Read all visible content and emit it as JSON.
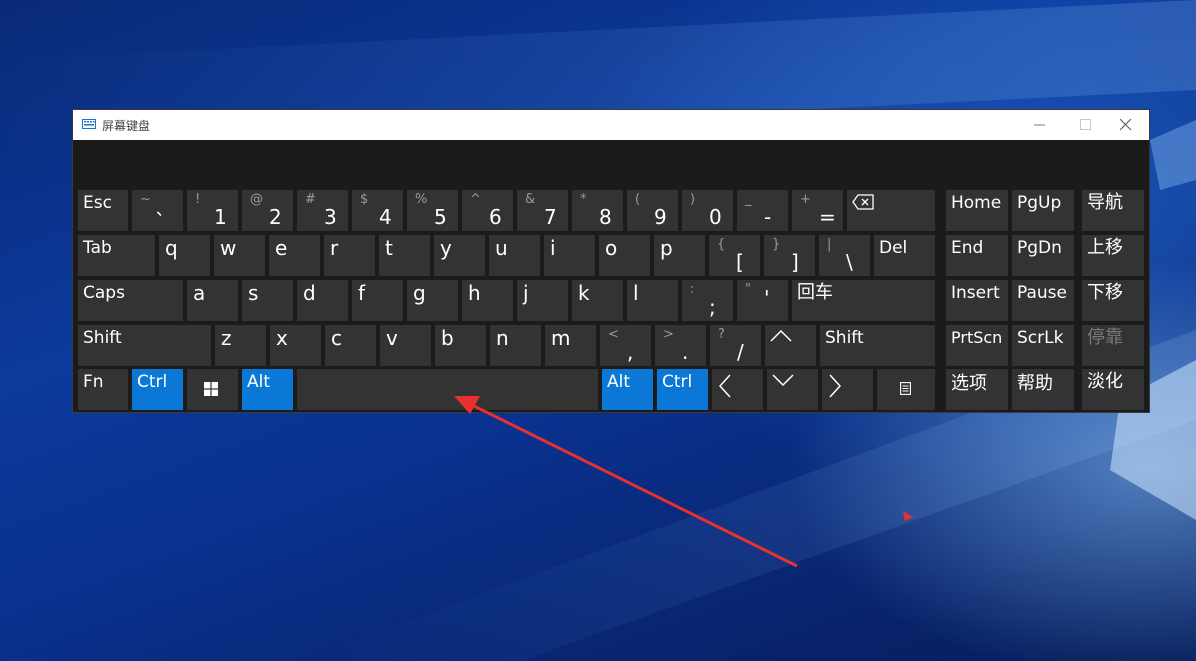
{
  "window": {
    "title": "屏幕键盘",
    "minimize_label": "—",
    "maximize_label": "☐",
    "close_label": "✕"
  },
  "keys": {
    "esc": "Esc",
    "backtick_sec": "~",
    "backtick_pri": "、",
    "n1_sec": "!",
    "n1_pri": "1",
    "n2_sec": "@",
    "n2_pri": "2",
    "n3_sec": "#",
    "n3_pri": "3",
    "n4_sec": "$",
    "n4_pri": "4",
    "n5_sec": "%",
    "n5_pri": "5",
    "n6_sec": "^",
    "n6_pri": "6",
    "n7_sec": "&",
    "n7_pri": "7",
    "n8_sec": "*",
    "n8_pri": "8",
    "n9_sec": "(",
    "n9_pri": "9",
    "n0_sec": ")",
    "n0_pri": "0",
    "minus_sec": "_",
    "minus_pri": "-",
    "equals_sec": "+",
    "equals_pri": "=",
    "tab": "Tab",
    "q": "q",
    "w": "w",
    "e": "e",
    "r": "r",
    "t": "t",
    "y": "y",
    "u": "u",
    "i": "i",
    "o": "o",
    "p": "p",
    "lbracket_sec": "{",
    "lbracket_pri": "[",
    "rbracket_sec": "}",
    "rbracket_pri": "]",
    "backslash_sec": "|",
    "backslash_pri": "\\",
    "del": "Del",
    "caps": "Caps",
    "a": "a",
    "s": "s",
    "d": "d",
    "f": "f",
    "g": "g",
    "h": "h",
    "j": "j",
    "k": "k",
    "l": "l",
    "semicolon_sec": ":",
    "semicolon_pri": ";",
    "quote_sec": "\"",
    "quote_pri": "'",
    "enter": "回车",
    "shift_left": "Shift",
    "z": "z",
    "x": "x",
    "c": "c",
    "v": "v",
    "b": "b",
    "n": "n",
    "m": "m",
    "comma_sec": "<",
    "comma_pri": ",",
    "period_sec": ">",
    "period_pri": ".",
    "slash_sec": "?",
    "slash_pri": "/",
    "shift_right": "Shift",
    "fn": "Fn",
    "ctrl_left": "Ctrl",
    "alt_left": "Alt",
    "alt_right": "Alt",
    "ctrl_right": "Ctrl",
    "home": "Home",
    "pgup": "PgUp",
    "nav": "导航",
    "end": "End",
    "pgdn": "PgDn",
    "move_up": "上移",
    "insert": "Insert",
    "pause": "Pause",
    "move_down": "下移",
    "prtscn": "PrtScn",
    "scrlk": "ScrLk",
    "dock": "停靠",
    "options": "选项",
    "help": "帮助",
    "fade": "淡化"
  },
  "colors": {
    "accent_blue": "#0b78d7",
    "key_bg": "#333333",
    "keyboard_bg": "#1b1b1b",
    "annotation_red": "#e8312f"
  },
  "icons": {
    "backspace": "backspace-icon",
    "windows": "windows-logo-icon",
    "arrows": [
      "arrow-up-icon",
      "arrow-left-icon",
      "arrow-down-icon",
      "arrow-right-icon"
    ],
    "menu": "context-menu-icon",
    "keyboard": "keyboard-icon"
  }
}
